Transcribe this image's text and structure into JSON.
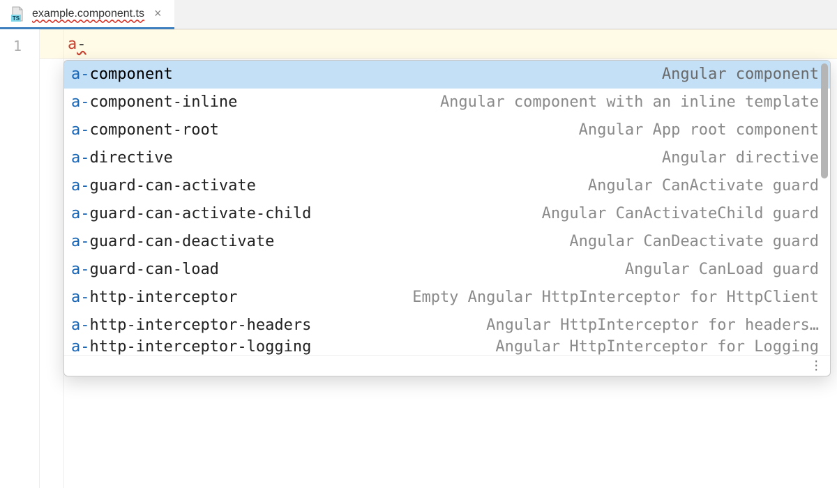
{
  "tab": {
    "filename": "example.component.ts",
    "icon": "typescript-file-icon"
  },
  "gutter": {
    "line": "1"
  },
  "editor": {
    "typed_prefix": "a",
    "typed_suffix": "-"
  },
  "completion": {
    "match_prefix": "a-",
    "items": [
      {
        "rest": "component",
        "desc": "Angular component",
        "selected": true
      },
      {
        "rest": "component-inline",
        "desc": "Angular component with an inline template"
      },
      {
        "rest": "component-root",
        "desc": "Angular App root component"
      },
      {
        "rest": "directive",
        "desc": "Angular directive"
      },
      {
        "rest": "guard-can-activate",
        "desc": "Angular CanActivate guard"
      },
      {
        "rest": "guard-can-activate-child",
        "desc": "Angular CanActivateChild guard"
      },
      {
        "rest": "guard-can-deactivate",
        "desc": "Angular CanDeactivate guard"
      },
      {
        "rest": "guard-can-load",
        "desc": "Angular CanLoad guard"
      },
      {
        "rest": "http-interceptor",
        "desc": "Empty Angular HttpInterceptor for HttpClient"
      },
      {
        "rest": "http-interceptor-headers",
        "desc": "Angular HttpInterceptor for headers…"
      },
      {
        "rest": "http-interceptor-logging",
        "desc": "Angular HttpInterceptor for Logging",
        "partial": true
      }
    ]
  }
}
